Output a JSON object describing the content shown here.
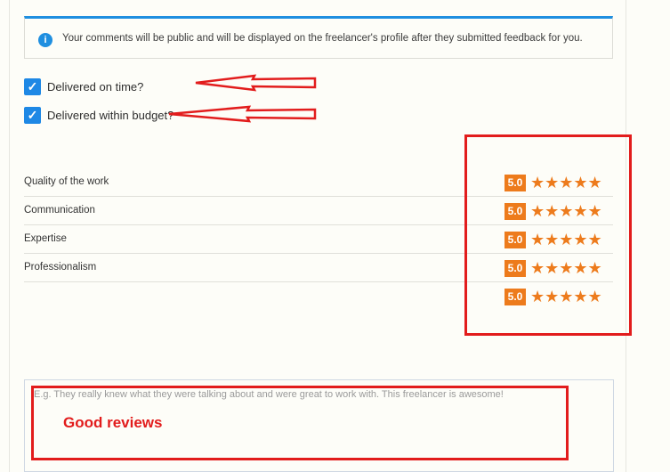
{
  "info": {
    "icon": "info-icon",
    "text": "Your comments will be public and will be displayed on the freelancer's profile after they submitted feedback for you."
  },
  "checkboxes": [
    {
      "label": "Delivered on time?",
      "checked": true
    },
    {
      "label": "Delivered within budget?",
      "checked": true
    }
  ],
  "ratings": [
    {
      "label": "Quality of the work",
      "score": "5.0",
      "stars": 5
    },
    {
      "label": "Communication",
      "score": "5.0",
      "stars": 5
    },
    {
      "label": "Expertise",
      "score": "5.0",
      "stars": 5
    },
    {
      "label": "Professionalism",
      "score": "5.0",
      "stars": 5
    },
    {
      "label": "",
      "score": "5.0",
      "stars": 5
    }
  ],
  "review": {
    "placeholder": "E.g. They really knew what they were talking about and were great to work with. This freelancer is awesome!"
  },
  "annotation": {
    "text": "Good reviews",
    "color": "#e21c1c"
  },
  "colors": {
    "accent_blue": "#1e88e5",
    "star_orange": "#ed7b1c"
  }
}
